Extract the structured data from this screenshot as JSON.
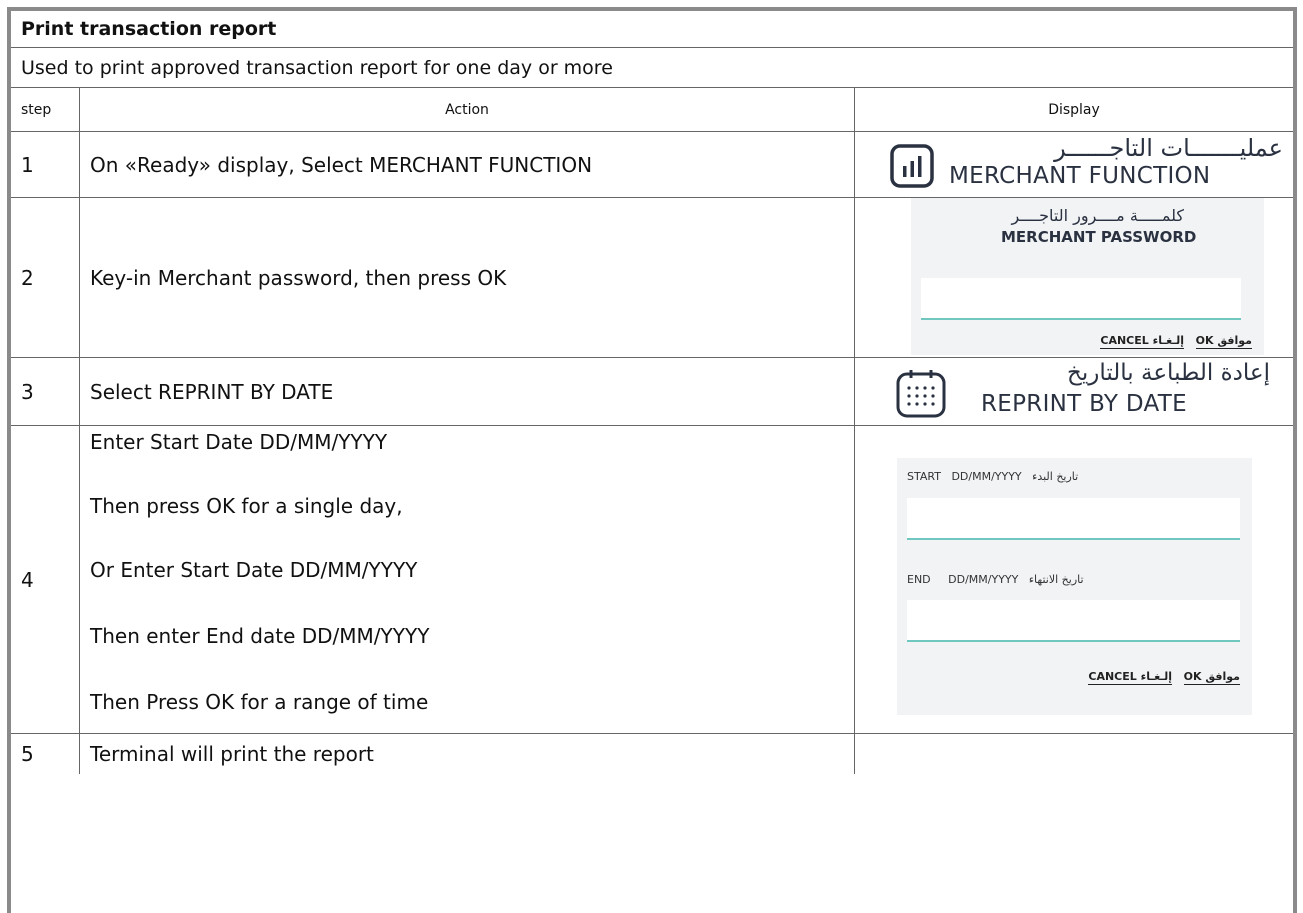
{
  "doc": {
    "title": "Print transaction report",
    "description": "Used to print approved transaction report for one day or more"
  },
  "headers": {
    "step": "step",
    "action": "Action",
    "display": "Display"
  },
  "rows": [
    {
      "step": "1",
      "action": "On «Ready» display, Select MERCHANT FUNCTION"
    },
    {
      "step": "2",
      "action": "Key-in Merchant password, then press OK"
    },
    {
      "step": "3",
      "action": "Select REPRINT BY DATE"
    },
    {
      "step": "4",
      "action_lines": [
        "Enter Start Date DD/MM/YYYY",
        "Then press OK for a single day,",
        "Or Enter Start Date DD/MM/YYYY",
        "Then enter End date DD/MM/YYYY",
        "Then Press OK for a range of time"
      ]
    },
    {
      "step": "5",
      "action": "Terminal will print the report"
    }
  ],
  "displays": {
    "merchant_function": {
      "arabic": "عمليـــــــات التاجــــــر",
      "english": "MERCHANT FUNCTION",
      "icon": "bar-chart-icon"
    },
    "merchant_password": {
      "arabic": "كلمـــــة مــــرور التاجــــر",
      "english": "MERCHANT PASSWORD",
      "ok": "OK",
      "ok_ar": "موافق",
      "cancel": "CANCEL",
      "cancel_ar": "إلـغـاء"
    },
    "reprint_by_date": {
      "arabic": "إعادة الطباعة بالتاريخ",
      "english": "REPRINT BY DATE",
      "icon": "calendar-icon"
    },
    "date_entry": {
      "start_label": "START",
      "start_format": "DD/MM/YYYY",
      "start_ar": "تاريخ البدء",
      "end_label": "END",
      "end_format": "DD/MM/YYYY",
      "end_ar": "تاريخ الانتهاء",
      "ok": "OK",
      "ok_ar": "موافق",
      "cancel": "CANCEL",
      "cancel_ar": "إلـغـاء"
    }
  },
  "colors": {
    "border": "#666666",
    "accent": "#6fc7bf",
    "panel": "#f2f3f5",
    "ink": "#2a3140"
  }
}
